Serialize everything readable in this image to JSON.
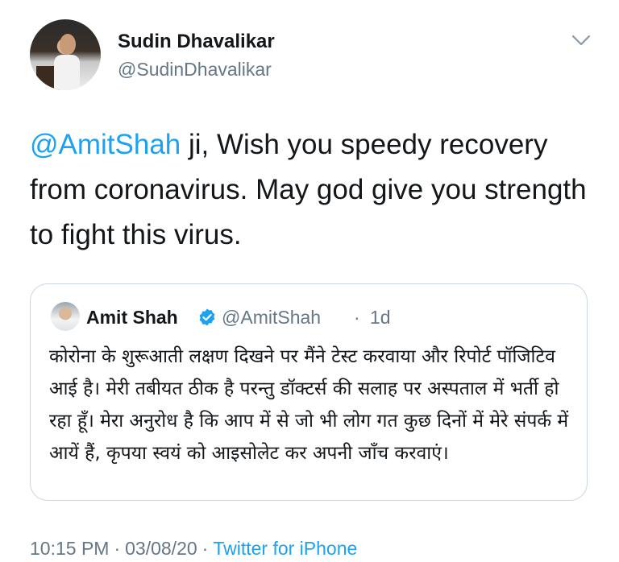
{
  "author": {
    "display_name": "Sudin Dhavalikar",
    "handle": "@SudinDhavalikar"
  },
  "tweet": {
    "mention": "@AmitShah",
    "text_rest": " ji, Wish you speedy recovery from coronavirus. May god give you strength to fight this virus."
  },
  "quoted": {
    "display_name": "Amit Shah",
    "handle": "@AmitShah",
    "dot": "·",
    "time": "1d",
    "text": "कोरोना के शुरूआती लक्षण दिखने पर मैंने टेस्ट करवाया और रिपोर्ट पॉजिटिव आई है। मेरी तबीयत ठीक है परन्तु डॉक्टर्स की सलाह पर अस्पताल में भर्ती हो रहा हूँ। मेरा अनुरोध है कि आप में से जो भी लोग गत कुछ दिनों में मेरे संपर्क में आयें हैं, कृपया स्वयं को आइसोलेट कर अपनी जाँच करवाएं।"
  },
  "footer": {
    "time": "10:15 PM",
    "sep1": "·",
    "date": "03/08/20",
    "sep2": "·",
    "source": "Twitter for iPhone"
  },
  "colors": {
    "link": "#1da1f2",
    "secondary_text": "#657786",
    "primary_text": "#14171a",
    "border": "#ccd6dd"
  },
  "icons": {
    "menu": "chevron-down-icon",
    "verified": "verified-badge-icon"
  }
}
